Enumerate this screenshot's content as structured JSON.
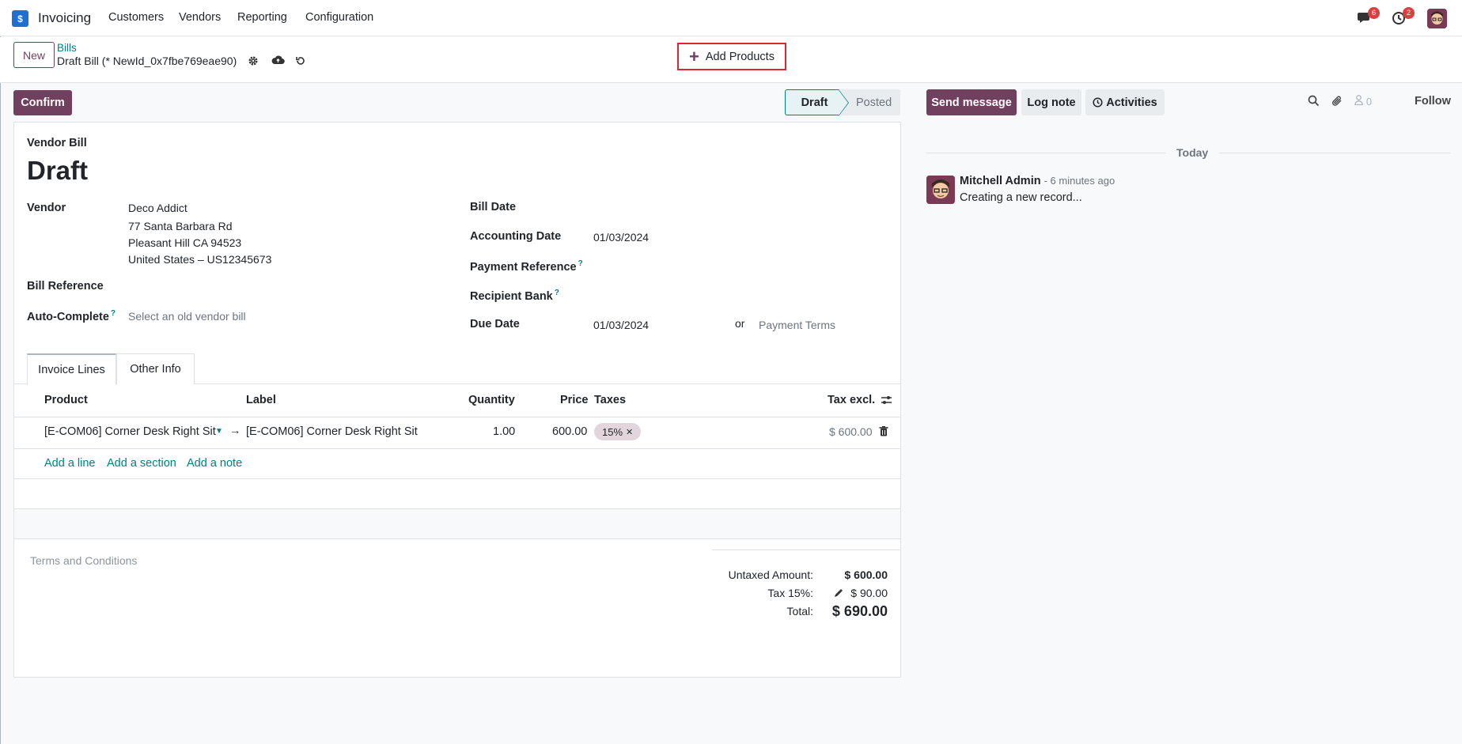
{
  "navbar": {
    "app_name": "Invoicing",
    "menu": [
      "Customers",
      "Vendors",
      "Reporting",
      "Configuration"
    ],
    "messages_badge": "6",
    "activities_badge": "2"
  },
  "control": {
    "new_label": "New",
    "breadcrumb_parent": "Bills",
    "breadcrumb_current": "Draft Bill (* NewId_0x7fbe769eae90)",
    "add_products_label": "Add Products"
  },
  "status": {
    "confirm_label": "Confirm",
    "stages": [
      "Draft",
      "Posted"
    ],
    "active_stage": "Draft"
  },
  "form": {
    "doc_type": "Vendor Bill",
    "title": "Draft",
    "vendor_label": "Vendor",
    "vendor_name": "Deco Addict",
    "vendor_address": [
      "77 Santa Barbara Rd",
      "Pleasant Hill CA 94523",
      "United States – US12345673"
    ],
    "bill_reference_label": "Bill Reference",
    "auto_complete_label": "Auto-Complete",
    "auto_complete_placeholder": "Select an old vendor bill",
    "bill_date_label": "Bill Date",
    "accounting_date_label": "Accounting Date",
    "accounting_date": "01/03/2024",
    "payment_reference_label": "Payment Reference",
    "recipient_bank_label": "Recipient Bank",
    "due_date_label": "Due Date",
    "due_date": "01/03/2024",
    "or_label": "or",
    "payment_terms_placeholder": "Payment Terms",
    "help_mark": "?"
  },
  "tabs": [
    "Invoice Lines",
    "Other Info"
  ],
  "table": {
    "headers": {
      "product": "Product",
      "label": "Label",
      "quantity": "Quantity",
      "price": "Price",
      "taxes": "Taxes",
      "tax_excl": "Tax excl."
    },
    "rows": [
      {
        "product": "[E-COM06] Corner Desk Right Sit",
        "label": "[E-COM06] Corner Desk Right Sit",
        "quantity": "1.00",
        "price": "600.00",
        "tax": "15%",
        "tax_excl": "$ 600.00"
      }
    ],
    "add_line": "Add a line",
    "add_section": "Add a section",
    "add_note": "Add a note"
  },
  "terms_placeholder": "Terms and Conditions",
  "totals": {
    "untaxed_label": "Untaxed Amount:",
    "untaxed_value": "$ 600.00",
    "tax_label": "Tax 15%:",
    "tax_value": "$ 90.00",
    "total_label": "Total:",
    "total_value": "$ 690.00"
  },
  "chatter": {
    "send_message": "Send message",
    "log_note": "Log note",
    "activities": "Activities",
    "followers_count": "0",
    "follow": "Follow",
    "today": "Today",
    "message": {
      "author": "Mitchell Admin",
      "time": "- 6 minutes ago",
      "body": "Creating a new record..."
    }
  },
  "colors": {
    "brand": "#71405e",
    "link": "#017e84",
    "highlight_border": "#e0262f"
  }
}
